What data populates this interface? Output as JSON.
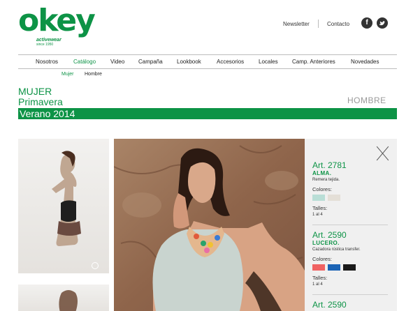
{
  "brand": {
    "name": "okey",
    "tagline": "activewear",
    "since": "since 1950"
  },
  "top_links": {
    "newsletter": "Newsletter",
    "contact": "Contacto"
  },
  "social": {
    "facebook": "f",
    "twitter": "t"
  },
  "nav": {
    "items": [
      {
        "label": "Nosotros"
      },
      {
        "label": "Catálogo",
        "active": true
      },
      {
        "label": "Video"
      },
      {
        "label": "Campaña"
      },
      {
        "label": "Lookbook"
      },
      {
        "label": "Accesorios"
      },
      {
        "label": "Locales"
      },
      {
        "label": "Camp. Anteriores"
      },
      {
        "label": "Novedades"
      }
    ],
    "sub": [
      {
        "label": "Mujer",
        "active": true
      },
      {
        "label": "Hombre"
      }
    ]
  },
  "catalog": {
    "line1": "MUJER",
    "line2": "Primavera",
    "season": "Verano 2014",
    "alt_link": "HOMBRE"
  },
  "products": [
    {
      "art": "Art. 2781",
      "name": "ALMA.",
      "desc": "Remera tejida.",
      "colors_label": "Colores:",
      "colors": [
        "#b9ded6",
        "#e4dfd7"
      ],
      "sizes_label": "Talles:",
      "sizes": "1 al 4"
    },
    {
      "art": "Art. 2590",
      "name": "LUCERO.",
      "desc": "Cazadora rústica transfer.",
      "colors_label": "Colores:",
      "colors": [
        "#f06262",
        "#1b63b5",
        "#1a1a1a"
      ],
      "sizes_label": "Talles:",
      "sizes": "1 al 4"
    },
    {
      "art": "Art. 2590"
    }
  ],
  "colors": {
    "brand_green": "#0d9346"
  }
}
